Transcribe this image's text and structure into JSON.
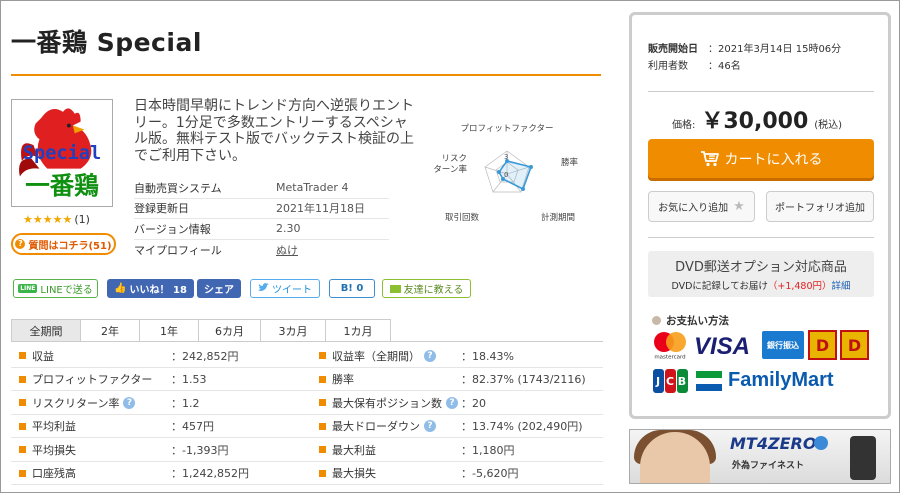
{
  "product": {
    "title": "一番鶏 Special",
    "logo_text_top": "Special",
    "logo_text_bottom": "一番鶏",
    "stars": "★★★★★",
    "review_count": "(1)",
    "qa_label": "質問はコチラ(51)",
    "description": "日本時間早朝にトレンド方向へ逆張りエントリー。1分足で多数エントリーするスペシャル版。無料テスト版でバックテスト検証の上でご利用下さい。",
    "info": [
      {
        "key": "自動売買システム",
        "value": "MetaTrader 4"
      },
      {
        "key": "登録更新日",
        "value": "2021年11月18日"
      },
      {
        "key": "バージョン情報",
        "value": "2.30"
      },
      {
        "key": "マイプロフィール",
        "value": "ぬけ"
      }
    ]
  },
  "radar": {
    "labels": {
      "pf": "プロフィットファクター",
      "win": "勝率",
      "period": "計測期間",
      "trades": "取引回数",
      "risk_line1": "リスク",
      "risk_line2": "ターン率"
    },
    "ticks": [
      "3",
      "0"
    ]
  },
  "social": {
    "line": "LINEで送る",
    "line_icon": "LINE",
    "fb_like": "いいね！ 18",
    "fb_share": "シェア",
    "tweet": "ツイート",
    "hatena": "B! 0",
    "mail": "友達に教える"
  },
  "tabs": [
    "全期間",
    "2年",
    "1年",
    "6カ月",
    "3カ月",
    "1カ月"
  ],
  "stats": {
    "left": [
      {
        "label": "収益",
        "value": "：242,852円",
        "help": false
      },
      {
        "label": "プロフィットファクター",
        "value": "：1.53",
        "help": false
      },
      {
        "label": "リスクリターン率",
        "value": "：1.2",
        "help": true
      },
      {
        "label": "平均利益",
        "value": "：457円",
        "help": false
      },
      {
        "label": "平均損失",
        "value": "：-1,393円",
        "help": false
      },
      {
        "label": "口座残高",
        "value": "：1,242,852円",
        "help": false
      }
    ],
    "right": [
      {
        "label": "収益率（全期間）",
        "value": "：18.43%",
        "help": true
      },
      {
        "label": "勝率",
        "value": "：82.37% (1743/2116)",
        "help": false
      },
      {
        "label": "最大保有ポジション数",
        "value": "：20",
        "help": true
      },
      {
        "label": "最大ドローダウン",
        "value": "：13.74% (202,490円)",
        "help": true
      },
      {
        "label": "最大利益",
        "value": "：1,180円",
        "help": false
      },
      {
        "label": "最大損失",
        "value": "：-5,620円",
        "help": false
      }
    ],
    "help_mark": "?"
  },
  "sidebar": {
    "sale_start_label": "販売開始日",
    "sale_start_value": "：2021年3月14日 15時06分",
    "users_label": "利用者数",
    "users_value": "：46名",
    "price_label": "価格:",
    "price_value": "￥30,000",
    "tax_label": "(税込)",
    "cart_button": "カートに入れる",
    "fav_button": "お気に入り追加",
    "portfolio_button": "ポートフォリオ追加",
    "dvd_title": "DVD郵送オプション対応商品",
    "dvd_text": "DVDに記録してお届け",
    "dvd_price": "（+1,480円）",
    "dvd_link": "詳細",
    "payment_title": "お支払い方法",
    "mastercard": "mastercard",
    "visa": "VISA",
    "bank": "銀行振込",
    "jcb": [
      "J",
      "C",
      "B"
    ],
    "familymart": "FamilyMart",
    "daily1": "D",
    "daily2": "D"
  },
  "banner": {
    "title": "MT4ZERO",
    "subtitle": "外為ファイネスト"
  },
  "colors": {
    "accent": "#f08c00",
    "radar_stroke": "#3a9ad8",
    "fb": "#4267b2"
  }
}
